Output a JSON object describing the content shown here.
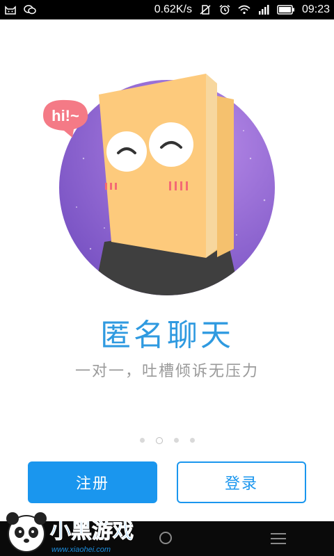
{
  "status_bar": {
    "speed": "0.62K/s",
    "time": "09:23",
    "left_icons": [
      "cat-notification-icon",
      "chat-notification-icon"
    ],
    "right_icons": [
      "no-sim-icon",
      "alarm-icon",
      "wifi-icon",
      "signal-icon",
      "battery-icon"
    ]
  },
  "hero": {
    "speech_bubble": "hi!~",
    "colors": {
      "circle": "#8a5fd0",
      "bag": "#fdc97a",
      "bag_side": "#f3b865",
      "body": "#444444",
      "bubble": "#f47a86"
    }
  },
  "intro": {
    "title": "匿名聊天",
    "subtitle": "一对一，吐槽倾诉无压力"
  },
  "pager": {
    "count": 4,
    "active_index": 1
  },
  "actions": {
    "register_label": "注册",
    "login_label": "登录",
    "accent": "#1a96ee"
  },
  "watermark": {
    "brand_text": "小黑游戏",
    "url": "www.xiaohei.com"
  }
}
